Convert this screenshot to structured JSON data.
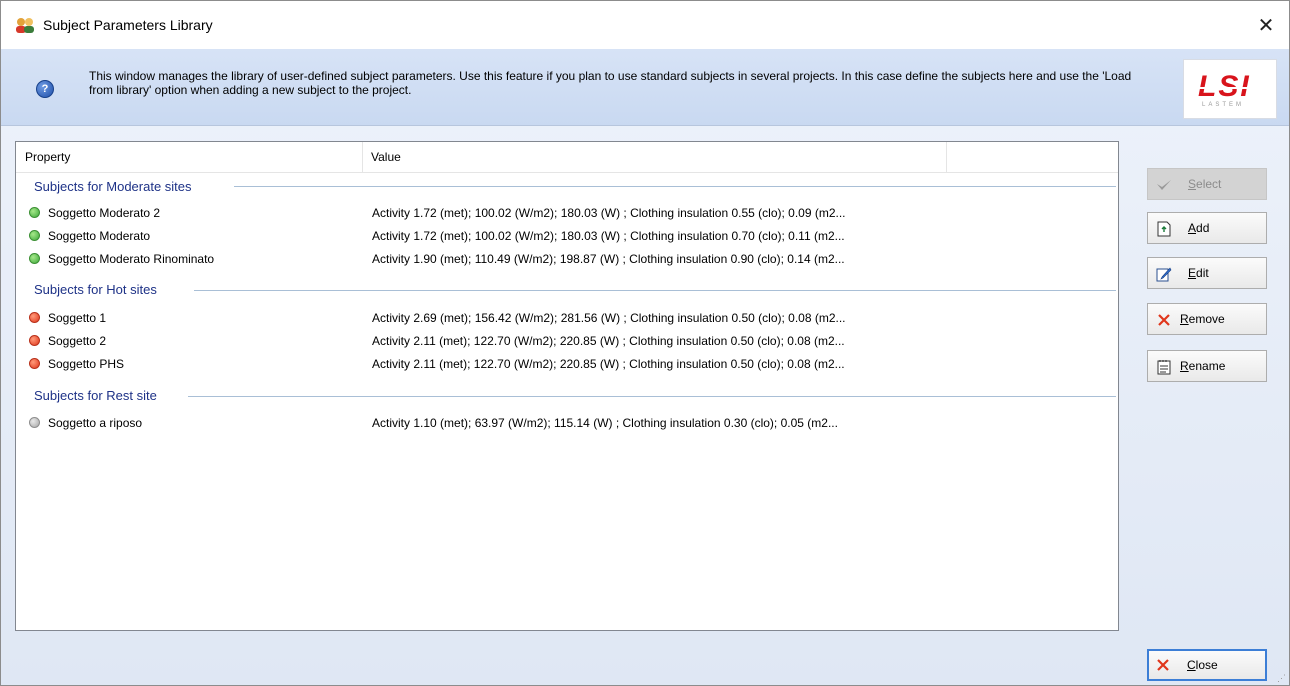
{
  "window": {
    "title": "Subject Parameters Library",
    "close_glyph": "✕"
  },
  "info": {
    "text": "This window manages the library of user-defined subject parameters. Use this feature if you plan to use standard subjects in several projects. In this case define the subjects here and use the 'Load from library' option when adding a new subject to the project.",
    "help_icon": "?"
  },
  "logo": {
    "text": "LSI",
    "subtext": "LASTEM"
  },
  "columns": {
    "property": "Property",
    "value": "Value"
  },
  "groups": [
    {
      "title": "Subjects for Moderate sites",
      "status": "green",
      "items": [
        {
          "name": "Soggetto Moderato 2",
          "value": "Activity 1.72 (met); 100.02 (W/m2); 180.03 (W) ; Clothing insulation 0.55 (clo); 0.09 (m2..."
        },
        {
          "name": "Soggetto Moderato",
          "value": "Activity 1.72 (met); 100.02 (W/m2); 180.03 (W) ; Clothing insulation 0.70 (clo); 0.11 (m2..."
        },
        {
          "name": "Soggetto Moderato Rinominato",
          "value": "Activity 1.90 (met); 110.49 (W/m2); 198.87 (W) ; Clothing insulation 0.90 (clo); 0.14 (m2..."
        }
      ]
    },
    {
      "title": "Subjects for Hot sites",
      "status": "red",
      "items": [
        {
          "name": "Soggetto 1",
          "value": "Activity 2.69 (met); 156.42 (W/m2); 281.56 (W) ; Clothing insulation 0.50 (clo); 0.08 (m2..."
        },
        {
          "name": "Soggetto 2",
          "value": "Activity 2.11 (met); 122.70 (W/m2); 220.85 (W) ; Clothing insulation 0.50 (clo); 0.08 (m2..."
        },
        {
          "name": "Soggetto PHS",
          "value": "Activity 2.11 (met); 122.70 (W/m2); 220.85 (W) ; Clothing insulation 0.50 (clo); 0.08 (m2..."
        }
      ]
    },
    {
      "title": "Subjects for Rest site",
      "status": "gray",
      "items": [
        {
          "name": "Soggetto a riposo",
          "value": "Activity 1.10 (met); 63.97 (W/m2); 115.14 (W) ; Clothing insulation 0.30 (clo); 0.05 (m2..."
        }
      ]
    }
  ],
  "buttons": {
    "select": {
      "first": "S",
      "rest": "elect",
      "icon": "select-check-icon",
      "enabled": false
    },
    "add": {
      "first": "A",
      "rest": "dd",
      "icon": "add-document-icon",
      "enabled": true
    },
    "edit": {
      "first": "E",
      "rest": "dit",
      "icon": "edit-pencil-icon",
      "enabled": true
    },
    "remove": {
      "first": "R",
      "rest": "emove",
      "icon": "remove-x-icon",
      "enabled": true
    },
    "rename": {
      "first": "R",
      "rest": "ename",
      "icon": "rename-notepad-icon",
      "enabled": true
    },
    "close": {
      "first": "C",
      "rest": "lose",
      "icon": "close-x-icon",
      "enabled": true
    }
  },
  "colors": {
    "group_header": "#1e3287",
    "remove_x": "#e0361b"
  }
}
